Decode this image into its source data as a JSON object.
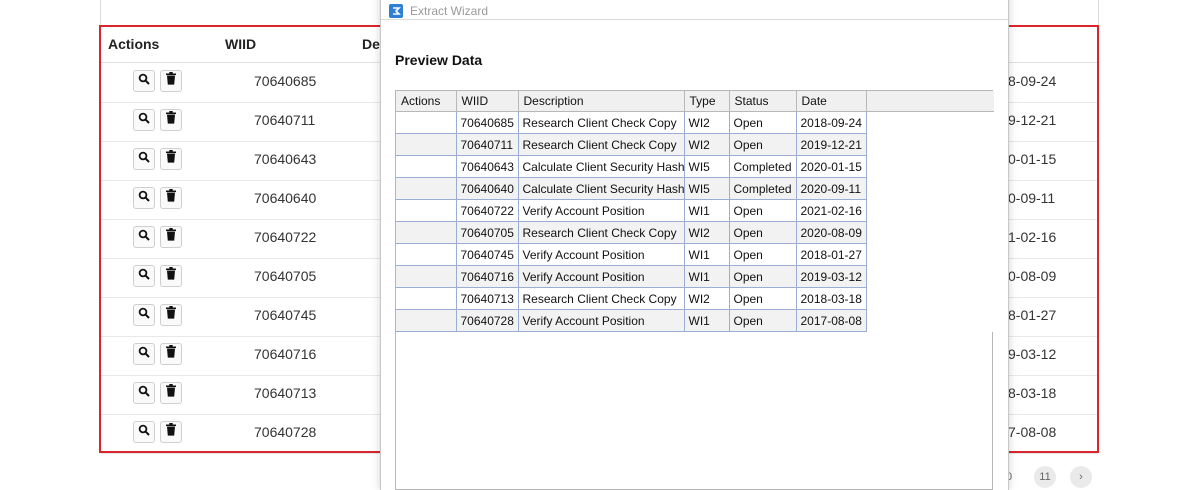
{
  "background": {
    "headers": {
      "actions": "Actions",
      "wiid": "WIID",
      "description_partial": "De"
    },
    "rows": [
      {
        "wiid": "70640685",
        "date_partial": "8-09-24"
      },
      {
        "wiid": "70640711",
        "date_partial": "9-12-21"
      },
      {
        "wiid": "70640643",
        "date_partial": "0-01-15"
      },
      {
        "wiid": "70640640",
        "date_partial": "0-09-11"
      },
      {
        "wiid": "70640722",
        "date_partial": "1-02-16"
      },
      {
        "wiid": "70640705",
        "date_partial": "0-08-09"
      },
      {
        "wiid": "70640745",
        "date_partial": "8-01-27"
      },
      {
        "wiid": "70640716",
        "date_partial": "9-03-12"
      },
      {
        "wiid": "70640713",
        "date_partial": "8-03-18"
      },
      {
        "wiid": "70640728",
        "date_partial": "7-08-08"
      }
    ],
    "pager": {
      "partial": "0",
      "page": "11",
      "next": "›"
    }
  },
  "wizard": {
    "title": "Extract Wizard",
    "preview_title": "Preview Data",
    "columns": [
      "Actions",
      "WIID",
      "Description",
      "Type",
      "Status",
      "Date",
      ""
    ],
    "rows": [
      {
        "actions": "",
        "wiid": "70640685",
        "description": "Research Client Check Copy",
        "type": "WI2",
        "status": "Open",
        "date": "2018-09-24"
      },
      {
        "actions": "",
        "wiid": "70640711",
        "description": "Research Client Check Copy",
        "type": "WI2",
        "status": "Open",
        "date": "2019-12-21"
      },
      {
        "actions": "",
        "wiid": "70640643",
        "description": "Calculate Client Security Hash",
        "type": "WI5",
        "status": "Completed",
        "date": "2020-01-15"
      },
      {
        "actions": "",
        "wiid": "70640640",
        "description": "Calculate Client Security Hash",
        "type": "WI5",
        "status": "Completed",
        "date": "2020-09-11"
      },
      {
        "actions": "",
        "wiid": "70640722",
        "description": "Verify Account Position",
        "type": "WI1",
        "status": "Open",
        "date": "2021-02-16"
      },
      {
        "actions": "",
        "wiid": "70640705",
        "description": "Research Client Check Copy",
        "type": "WI2",
        "status": "Open",
        "date": "2020-08-09"
      },
      {
        "actions": "",
        "wiid": "70640745",
        "description": "Verify Account Position",
        "type": "WI1",
        "status": "Open",
        "date": "2018-01-27"
      },
      {
        "actions": "",
        "wiid": "70640716",
        "description": "Verify Account Position",
        "type": "WI1",
        "status": "Open",
        "date": "2019-03-12"
      },
      {
        "actions": "",
        "wiid": "70640713",
        "description": "Research Client Check Copy",
        "type": "WI2",
        "status": "Open",
        "date": "2018-03-18"
      },
      {
        "actions": "",
        "wiid": "70640728",
        "description": "Verify Account Position",
        "type": "WI1",
        "status": "Open",
        "date": "2017-08-08"
      }
    ]
  },
  "colors": {
    "highlight": "#d9262c",
    "grid_line": "#9aaed1",
    "alt_row": "#f2f2f2",
    "wizard_icon": "#2f7fd6"
  },
  "icons": {
    "row_view": "search-icon",
    "row_delete": "trash-icon",
    "wizard": "wizard-app-icon"
  }
}
